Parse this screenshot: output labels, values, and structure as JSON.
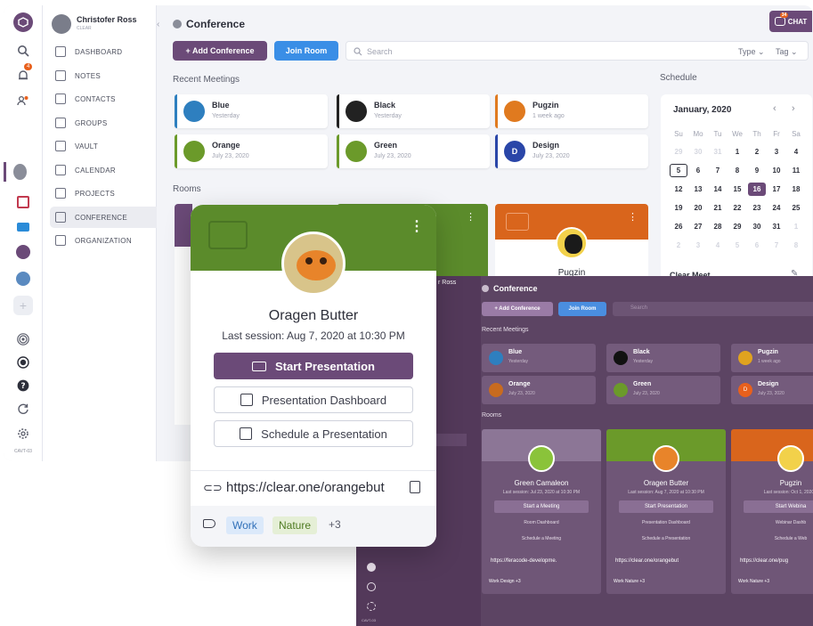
{
  "window": {
    "title": "Conference",
    "chat_label": "CHAT",
    "chat_badge": "34",
    "add_conference": "+ Add Conference",
    "join_room": "Join Room",
    "search_placeholder": "Search",
    "filter_type": "Type",
    "filter_tag": "Tag"
  },
  "user": {
    "name": "Christofer Ross",
    "company": "CLEAR"
  },
  "rail": {
    "badge": "4",
    "label": "CAVT-03"
  },
  "sidebar": {
    "items": [
      {
        "label": "DASHBOARD"
      },
      {
        "label": "NOTES"
      },
      {
        "label": "CONTACTS"
      },
      {
        "label": "GROUPS"
      },
      {
        "label": "VAULT"
      },
      {
        "label": "CALENDAR"
      },
      {
        "label": "PROJECTS"
      },
      {
        "label": "CONFERENCE"
      },
      {
        "label": "ORGANIZATION"
      }
    ]
  },
  "recent": {
    "heading": "Recent Meetings",
    "meetings": [
      {
        "name": "Blue",
        "time": "Yesterday",
        "color": "#2e7fbf"
      },
      {
        "name": "Black",
        "time": "Yesterday",
        "color": "#222222"
      },
      {
        "name": "Pugzin",
        "time": "1 week ago",
        "color": "#e07a1f"
      },
      {
        "name": "Orange",
        "time": "July 23, 2020",
        "color": "#6b9a2a"
      },
      {
        "name": "Green",
        "time": "July 23, 2020",
        "color": "#6b9a2a"
      },
      {
        "name": "Design",
        "time": "July 23, 2020",
        "color": "#2a46a8",
        "initial": "D"
      }
    ]
  },
  "rooms": {
    "heading": "Rooms",
    "pugzin_label": "Pugzin"
  },
  "schedule": {
    "heading": "Schedule",
    "month": "January, 2020",
    "weekdays": [
      "Su",
      "Mo",
      "Tu",
      "We",
      "Th",
      "Fr",
      "Sa"
    ],
    "weeks": [
      [
        "29",
        "30",
        "31",
        "1",
        "2",
        "3",
        "4"
      ],
      [
        "5",
        "6",
        "7",
        "8",
        "9",
        "10",
        "11"
      ],
      [
        "12",
        "13",
        "14",
        "15",
        "16",
        "17",
        "18"
      ],
      [
        "19",
        "20",
        "21",
        "22",
        "23",
        "24",
        "25"
      ],
      [
        "26",
        "27",
        "28",
        "29",
        "30",
        "31",
        "1"
      ],
      [
        "2",
        "3",
        "4",
        "5",
        "6",
        "7",
        "8"
      ]
    ],
    "today": "16",
    "outlined": "5",
    "clear_meet": "Clear Meet"
  },
  "popup": {
    "name": "Oragen Butter",
    "session": "Last session: Aug 7, 2020 at 10:30 PM",
    "start": "Start Presentation",
    "dashboard": "Presentation Dashboard",
    "schedule": "Schedule a Presentation",
    "url": "https://clear.one/orangebut",
    "tags": [
      "Work",
      "Nature"
    ],
    "more": "+3",
    "header_color": "#5b8b2b"
  },
  "dark": {
    "user_fragment": "r Ross",
    "title": "Conference",
    "add_conference": "+ Add Conference",
    "join_room": "Join Room",
    "search": "Search",
    "recent_heading": "Recent Meetings",
    "meetings": [
      {
        "name": "Blue",
        "time": "Yesterday"
      },
      {
        "name": "Black",
        "time": "Yesterday"
      },
      {
        "name": "Pugzin",
        "time": "1 week ago"
      },
      {
        "name": "Orange",
        "time": "July 23, 2020"
      },
      {
        "name": "Green",
        "time": "July 23, 2020"
      },
      {
        "name": "Design",
        "time": "July 23, 2020",
        "initial": "D"
      }
    ],
    "rooms_heading": "Rooms",
    "rooms": [
      {
        "name": "Green Camaleon",
        "session": "Last session: Jul 23, 2020 at 10:30 PM",
        "action": "Start a Meeting",
        "link1": "Room Dashboard",
        "link2": "Schedule a Meeting",
        "url": "https://feracode-developme.",
        "tags": "Work  Design  +3"
      },
      {
        "name": "Oragen Butter",
        "session": "Last session: Aug 7, 2020 at 10:30 PM",
        "action": "Start Presentation",
        "link1": "Presentation Dashboard",
        "link2": "Schedule a Presentation",
        "url": "https://clear.one/orangebut",
        "tags": "Work  Nature  +3"
      },
      {
        "name": "Pugzin",
        "session": "Last session: Oct 1, 2020 a",
        "action": "Start Webina",
        "link1": "Webinar Dashb",
        "link2": "Schedule a Web",
        "url": "https://clear.one/pug",
        "tags": "Work  Nature  +3"
      }
    ],
    "rail_label": "CAVT-03"
  },
  "colors": {
    "accent_purple": "#6b4a78",
    "join_blue": "#3a8ee6",
    "green_header": "#5b8b2b",
    "orange_header": "#d9651c",
    "dark_bg": "#5c4463",
    "today_bg": "#6b4a78"
  }
}
